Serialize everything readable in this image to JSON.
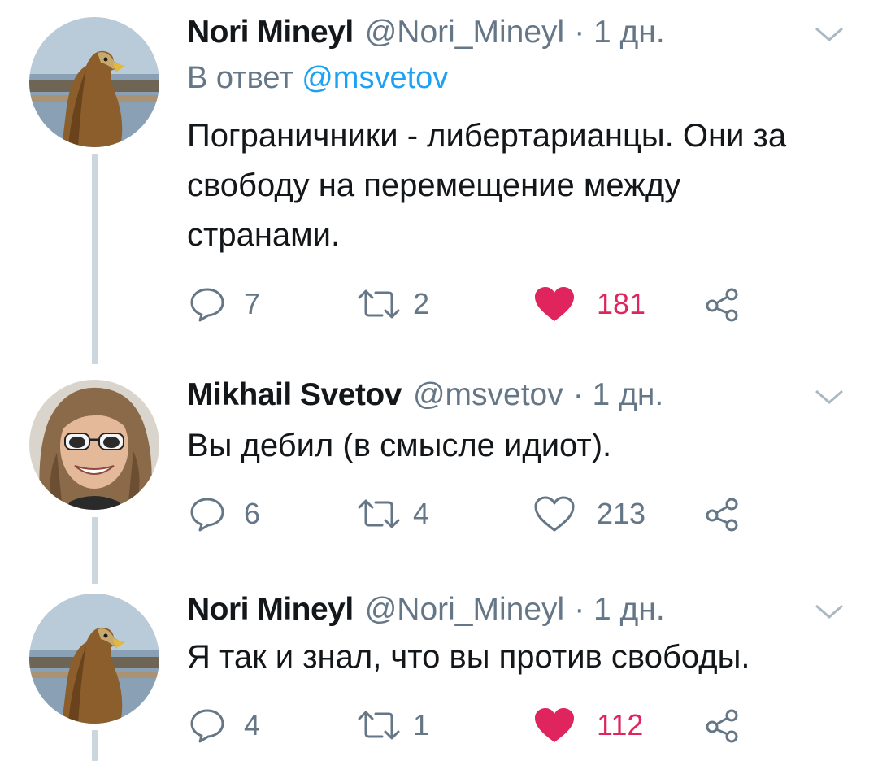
{
  "tweets": [
    {
      "author": "Nori Mineyl",
      "handle": "@Nori_Mineyl",
      "time": "· 1 дн.",
      "reply_prefix": "В ответ",
      "reply_to": "@msvetov",
      "text": "Пограничники - либертарианцы. Они за свободу на перемещение между странами.",
      "replies": "7",
      "retweets": "2",
      "likes": "181",
      "liked": true,
      "avatar_icon": "eagle-avatar"
    },
    {
      "author": "Mikhail Svetov",
      "handle": "@msvetov",
      "time": "· 1 дн.",
      "text": "Вы дебил (в смысле идиот).",
      "replies": "6",
      "retweets": "4",
      "likes": "213",
      "liked": false,
      "avatar_icon": "man-sunglasses-avatar"
    },
    {
      "author": "Nori Mineyl",
      "handle": "@Nori_Mineyl",
      "time": "· 1 дн.",
      "text": "Я так и знал, что вы против свободы.",
      "replies": "4",
      "retweets": "1",
      "likes": "112",
      "liked": true,
      "avatar_icon": "eagle-avatar"
    }
  ],
  "icons": {
    "reply": "reply-icon",
    "retweet": "retweet-icon",
    "like": "heart-icon",
    "share": "share-icon",
    "more": "chevron-down-icon"
  },
  "colors": {
    "name": "#14171a",
    "meta": "#657786",
    "mention": "#1da1f2",
    "liked": "#e0245e",
    "thread_line": "#ccd6dd"
  }
}
